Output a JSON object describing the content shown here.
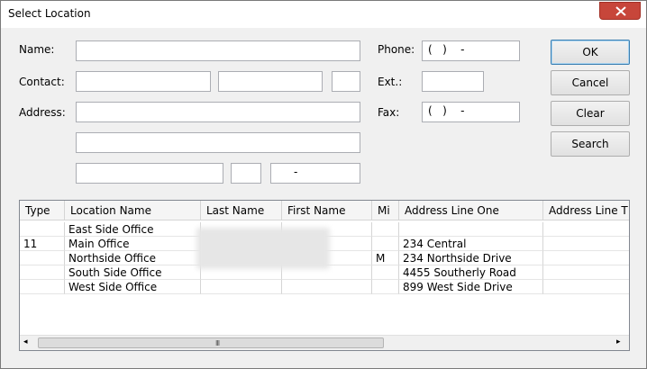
{
  "window": {
    "title": "Select Location",
    "close_glyph": "✕"
  },
  "labels": {
    "name": "Name:",
    "contact": "Contact:",
    "address": "Address:",
    "phone": "Phone:",
    "ext": "Ext.:",
    "fax": "Fax:"
  },
  "fields": {
    "name": "",
    "contact_first": "",
    "contact_last": "",
    "contact_mi": "",
    "address1": "",
    "address2": "",
    "city": "",
    "state": "",
    "zip": "-",
    "phone": "(   )    -",
    "ext": "",
    "fax": "(   )    -"
  },
  "buttons": {
    "ok": "OK",
    "cancel": "Cancel",
    "clear": "Clear",
    "search": "Search"
  },
  "table": {
    "columns": [
      "Type",
      "Location Name",
      "Last Name",
      "First Name",
      "Mi",
      "Address Line One",
      "Address Line T"
    ],
    "rows": [
      [
        "",
        "East Side Office",
        "",
        "",
        "",
        "",
        ""
      ],
      [
        "11",
        "Main Office",
        "",
        "",
        "",
        "234 Central",
        ""
      ],
      [
        "",
        "Northside Office",
        "",
        "",
        "M",
        "234 Northside Drive",
        ""
      ],
      [
        "",
        "South Side Office",
        "",
        "",
        "",
        "4455 Southerly Road",
        ""
      ],
      [
        "",
        "West Side Office",
        "",
        "",
        "",
        "899 West Side Drive",
        ""
      ]
    ]
  },
  "scrollbar": {
    "left_arrow": "◂",
    "right_arrow": "▸",
    "grip": "III"
  }
}
